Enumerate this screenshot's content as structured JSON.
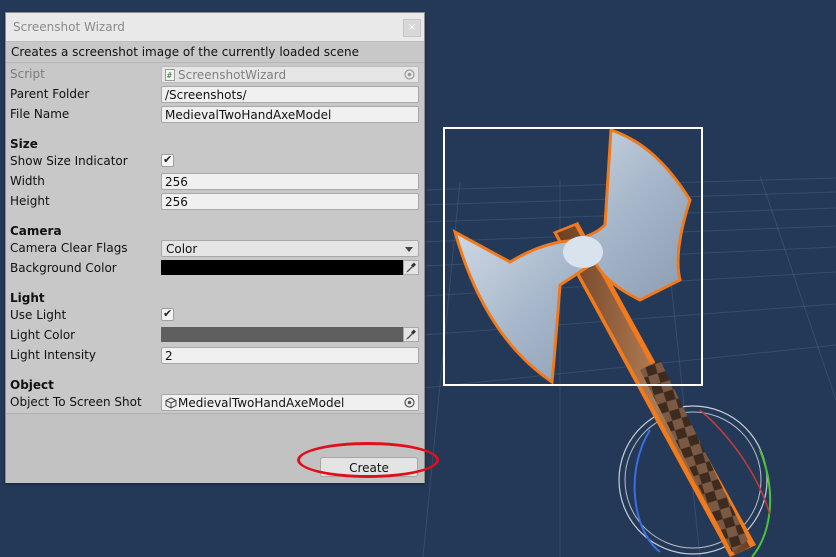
{
  "window": {
    "title": "Screenshot Wizard",
    "close_label": "×",
    "help_text": "Creates a screenshot image of the currently loaded scene"
  },
  "fields": {
    "script": {
      "label": "Script",
      "value": "ScreenshotWizard"
    },
    "parent_folder": {
      "label": "Parent Folder",
      "value": "/Screenshots/"
    },
    "file_name": {
      "label": "File Name",
      "value": "MedievalTwoHandAxeModel"
    }
  },
  "size": {
    "header": "Size",
    "show_size_indicator": {
      "label": "Show Size Indicator",
      "checked": true,
      "mark": "✔"
    },
    "width": {
      "label": "Width",
      "value": "256"
    },
    "height": {
      "label": "Height",
      "value": "256"
    }
  },
  "camera": {
    "header": "Camera",
    "clear_flags": {
      "label": "Camera Clear Flags",
      "value": "Color"
    },
    "background_color": {
      "label": "Background Color",
      "color": "#000000"
    }
  },
  "light": {
    "header": "Light",
    "use_light": {
      "label": "Use Light",
      "checked": true,
      "mark": "✔"
    },
    "light_color": {
      "label": "Light Color",
      "color": "#5f5f5f"
    },
    "light_intensity": {
      "label": "Light Intensity",
      "value": "2"
    }
  },
  "object": {
    "header": "Object",
    "object_to_screenshot": {
      "label": "Object To Screen Shot",
      "value": "MedievalTwoHandAxeModel"
    }
  },
  "actions": {
    "create_label": "Create"
  },
  "colors": {
    "scene_background": "#243957",
    "selection_outline": "#f07a1c",
    "highlight_ellipse": "#e0101a",
    "axe_blade": "#b9c7d9",
    "axe_handle": "#8a5a38"
  },
  "icons": {
    "script_icon": "script-file-icon",
    "object_icon": "cube-icon",
    "picker": "object-picker-icon",
    "eyedropper": "eyedropper-icon"
  }
}
